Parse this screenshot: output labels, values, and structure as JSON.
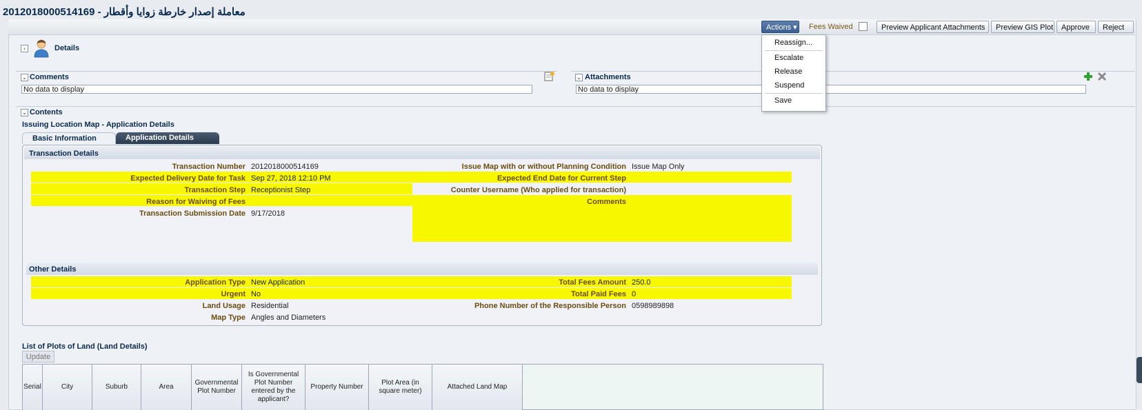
{
  "page": {
    "title": "معاملة إصدار خارطة زوايا وأقطار - 2012018000514169"
  },
  "toolbar": {
    "actions_label": "Actions ▾",
    "fees_waived_label": "Fees Waived",
    "preview_attachments_label": "Preview Applicant Attachments",
    "preview_gis_label": "Preview GIS Plot",
    "approve_label": "Approve",
    "reject_label": "Reject"
  },
  "actions_menu": {
    "items": [
      "Reassign...",
      "Escalate",
      "Release",
      "Suspend",
      "Save"
    ]
  },
  "details": {
    "title": "Details",
    "disclose": "›"
  },
  "comments": {
    "title": "Comments",
    "empty": "No data to display"
  },
  "attachments": {
    "title": "Attachments",
    "empty": "No data to display"
  },
  "contents": {
    "title": "Contents",
    "subtitle": "Issuing Location Map - Application Details",
    "tabs": [
      "Basic Information",
      "Application Details"
    ]
  },
  "transaction_details": {
    "title": "Transaction Details",
    "left": [
      {
        "label": "Transaction Number",
        "value": "2012018000514169"
      },
      {
        "label": "Expected Delivery Date for Task",
        "value": "Sep 27, 2018 12:10 PM"
      },
      {
        "label": "Transaction Step",
        "value": "Receptionist Step"
      },
      {
        "label": "Reason for Waiving of Fees",
        "value": ""
      },
      {
        "label": "Transaction Submission Date",
        "value": "9/17/2018"
      }
    ],
    "right": [
      {
        "label": "Issue Map with or without Planning Condition",
        "value": "Issue Map Only"
      },
      {
        "label": "Expected End Date for Current Step",
        "value": ""
      },
      {
        "label": "Counter Username (Who applied for transaction)",
        "value": ""
      },
      {
        "label": "Comments",
        "value": ""
      }
    ]
  },
  "other_details": {
    "title": "Other Details",
    "left": [
      {
        "label": "Application Type",
        "value": "New Application"
      },
      {
        "label": "Urgent",
        "value": "No"
      },
      {
        "label": "Land Usage",
        "value": "Residential"
      },
      {
        "label": "Map Type",
        "value": "Angles and Diameters"
      }
    ],
    "right": [
      {
        "label": "Total Fees Amount",
        "value": "250.0"
      },
      {
        "label": "Total Paid Fees",
        "value": "0"
      },
      {
        "label": "Phone Number of the Responsible Person",
        "value": "0598989898"
      }
    ]
  },
  "plots": {
    "title": "List of Plots of Land (Land Details)",
    "update_label": "Update",
    "columns": [
      "Serial",
      "City",
      "Suburb",
      "Area",
      "Governmental Plot Number",
      "Is Governmental Plot Number entered by the applicant?",
      "Property Number",
      "Plot Area (in square meter)",
      "Attached Land Map"
    ]
  },
  "colors": {
    "highlight": "#f7f700",
    "header_text": "#0a2a4d",
    "label_text": "#6b4d10"
  },
  "icons": [
    "user-icon",
    "add-comment-icon",
    "add-icon",
    "delete-icon"
  ]
}
